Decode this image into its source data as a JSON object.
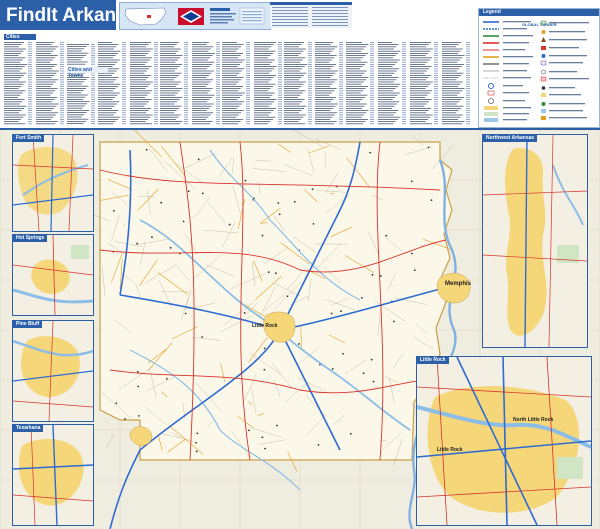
{
  "title": "FindIt Arkansas",
  "index": {
    "cities_heading": "Cities",
    "towns_heading": "Cities and Towns"
  },
  "legend": {
    "title": "Legend",
    "publisher": "GLOBAL TURNER"
  },
  "insets": {
    "fort_smith": "Fort Smith",
    "hot_springs": "Hot Springs",
    "pine_bluff": "Pine Bluff",
    "texarkana": "Texarkana",
    "northwest_arkansas": "Northwest Arkansas",
    "little_rock": "Little Rock"
  },
  "map": {
    "memphis": "Memphis",
    "little_rock": "Little Rock",
    "north_little_rock": "North Little Rock"
  },
  "colors": {
    "brand": "#2b5fa8",
    "land": "#f2f0e2",
    "urban": "#f5d77a",
    "interstate": "#2e6bd0",
    "us_highway": "#d8332a",
    "water": "#9fc6ea"
  }
}
